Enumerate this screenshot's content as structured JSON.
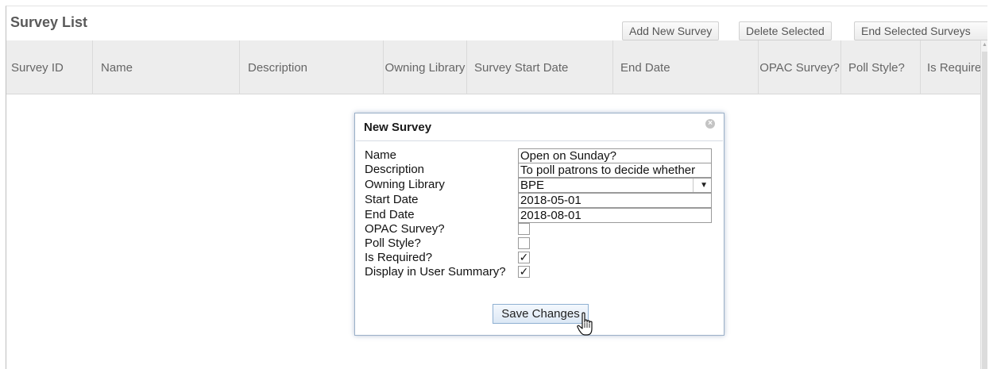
{
  "page": {
    "title": "Survey List"
  },
  "toolbar": {
    "add_label": "Add New Survey",
    "delete_label": "Delete Selected",
    "end_label": "End Selected Surveys"
  },
  "grid": {
    "columns": [
      "Survey ID",
      "Name",
      "Description",
      "Owning Library",
      "Survey Start Date",
      "End Date",
      "OPAC Survey?",
      "Poll Style?",
      "Is Required"
    ]
  },
  "dialog": {
    "title": "New Survey",
    "close_icon": "close-circle-icon",
    "fields": {
      "name": {
        "label": "Name",
        "value": "Open on Sunday?"
      },
      "description": {
        "label": "Description",
        "value": "To poll patrons to decide whether"
      },
      "owning_library": {
        "label": "Owning Library",
        "value": "BPE"
      },
      "start_date": {
        "label": "Start Date",
        "value": "2018-05-01"
      },
      "end_date": {
        "label": "End Date",
        "value": "2018-08-01"
      },
      "opac_survey": {
        "label": "OPAC Survey?",
        "checked": false
      },
      "poll_style": {
        "label": "Poll Style?",
        "checked": false
      },
      "is_required": {
        "label": "Is Required?",
        "checked": true
      },
      "display_in_summary": {
        "label": "Display in User Summary?",
        "checked": true
      }
    },
    "save_label": "Save Changes",
    "check_glyph": "✓",
    "select_arrow_glyph": "▼"
  },
  "colors": {
    "header_bg": "#ededed",
    "dialog_border": "#9bb0c8",
    "save_button_bg": "#dce8f5"
  }
}
